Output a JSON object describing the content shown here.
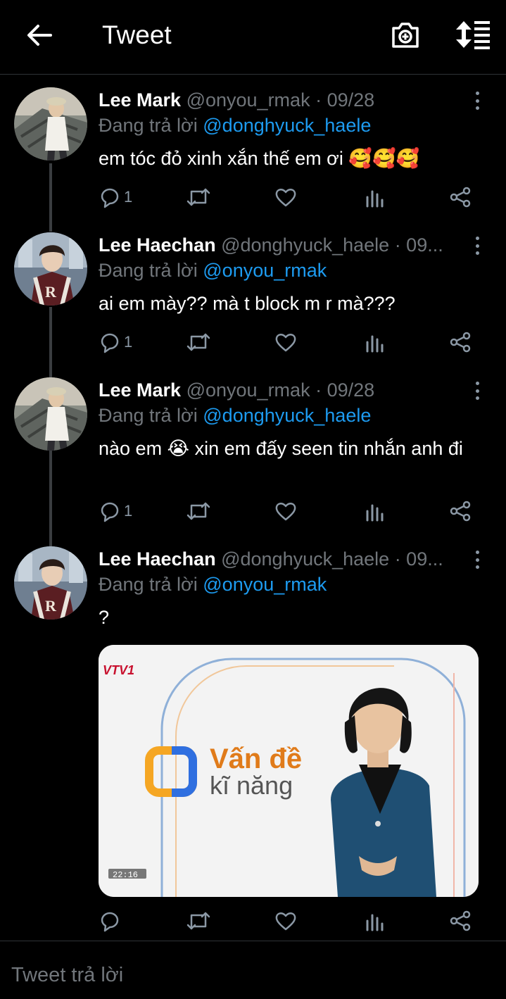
{
  "header": {
    "title": "Tweet",
    "back_icon": "arrow-left-icon",
    "camera_icon": "camera-plus-icon",
    "sort_icon": "sort-list-icon"
  },
  "tweets": [
    {
      "name": "Lee Mark",
      "handle": "@onyou_rmak",
      "date_sep": " · 09/28",
      "reply_prefix": "Đang trả lời ",
      "reply_to": "@donghyuck_haele",
      "text": "em tóc đỏ xinh xắn thế em ơi 🥰🥰🥰",
      "reply_count": "1"
    },
    {
      "name": "Lee Haechan",
      "handle": "@donghyuck_haele",
      "date_sep": " · 09...",
      "reply_prefix": "Đang trả lời ",
      "reply_to": "@onyou_rmak",
      "text": "ai em mày?? mà t block m r mà???",
      "reply_count": "1"
    },
    {
      "name": "Lee Mark",
      "handle": "@onyou_rmak",
      "date_sep": " · 09/28",
      "reply_prefix": "Đang trả lời ",
      "reply_to": "@donghyuck_haele",
      "text": "nào em 😭 xin em đấy seen tin nhắn anh đi",
      "reply_count": "1"
    },
    {
      "name": "Lee Haechan",
      "handle": "@donghyuck_haele",
      "date_sep": " · 09...",
      "reply_prefix": "Đang trả lời ",
      "reply_to": "@onyou_rmak",
      "text": "?",
      "reply_count": ""
    }
  ],
  "media": {
    "channel_logo": "VTV1",
    "show_title_line1": "Vấn đề",
    "show_title_line2": "kĩ năng",
    "clock": "22:16"
  },
  "composer": {
    "placeholder": "Tweet trả lời"
  },
  "colors": {
    "background": "#000000",
    "mention": "#1d9bf0",
    "muted": "#71767b",
    "icon": "#8b98a5"
  }
}
